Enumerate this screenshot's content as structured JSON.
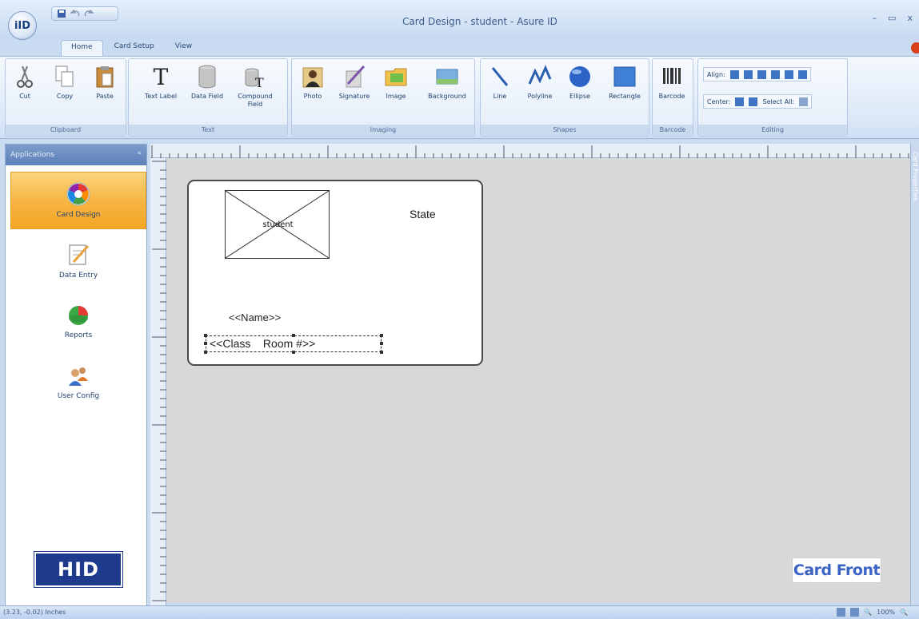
{
  "window": {
    "title": "Card Design - student - Asure ID",
    "app_button": "iID",
    "controls": [
      "–",
      "▭",
      "x"
    ]
  },
  "quick_access": [
    "save-icon",
    "undo-icon",
    "redo-icon"
  ],
  "tabs": [
    {
      "label": "Home",
      "active": true
    },
    {
      "label": "Card Setup",
      "active": false
    },
    {
      "label": "View",
      "active": false
    }
  ],
  "ribbon": {
    "clipboard": {
      "label": "Clipboard",
      "buttons": [
        "Cut",
        "Copy",
        "Paste"
      ]
    },
    "text": {
      "label": "Text",
      "buttons": [
        "Text Label",
        "Data Field",
        "Compound Field"
      ]
    },
    "imaging": {
      "label": "Imaging",
      "buttons": [
        "Photo",
        "Signature",
        "Image",
        "Background"
      ]
    },
    "shapes": {
      "label": "Shapes",
      "buttons": [
        "Line",
        "Polyline",
        "Ellipse",
        "Rectangle"
      ]
    },
    "barcode": {
      "label": "Barcode",
      "buttons": [
        "Barcode"
      ]
    },
    "editing": {
      "label": "Editing",
      "align_label": "Align:",
      "center_label": "Center:",
      "select_all_label": "Select All:"
    }
  },
  "left_panel": {
    "header": "Applications",
    "pin": "«",
    "items": [
      {
        "label": "Card Design",
        "icon": "color-wheel-icon",
        "active": true
      },
      {
        "label": "Data Entry",
        "icon": "notepad-icon",
        "active": false
      },
      {
        "label": "Reports",
        "icon": "pie-chart-icon",
        "active": false
      },
      {
        "label": "User Config",
        "icon": "users-icon",
        "active": false
      }
    ],
    "logo": "HID"
  },
  "right_strip": "Card Properties",
  "card": {
    "photo_label": "student",
    "state": "State",
    "name_field": "<<Name>>",
    "class_field": "<<Class    Room #>>"
  },
  "card_front_label": "Card Front",
  "status": {
    "coords": "(3.23, -0.02) Inches",
    "zoom": "100%"
  },
  "colors": {
    "accent": "#f7b43f",
    "brand": "#1e3a8c",
    "ribbon": "#dde9f8",
    "canvas": "#d8d8d8"
  }
}
